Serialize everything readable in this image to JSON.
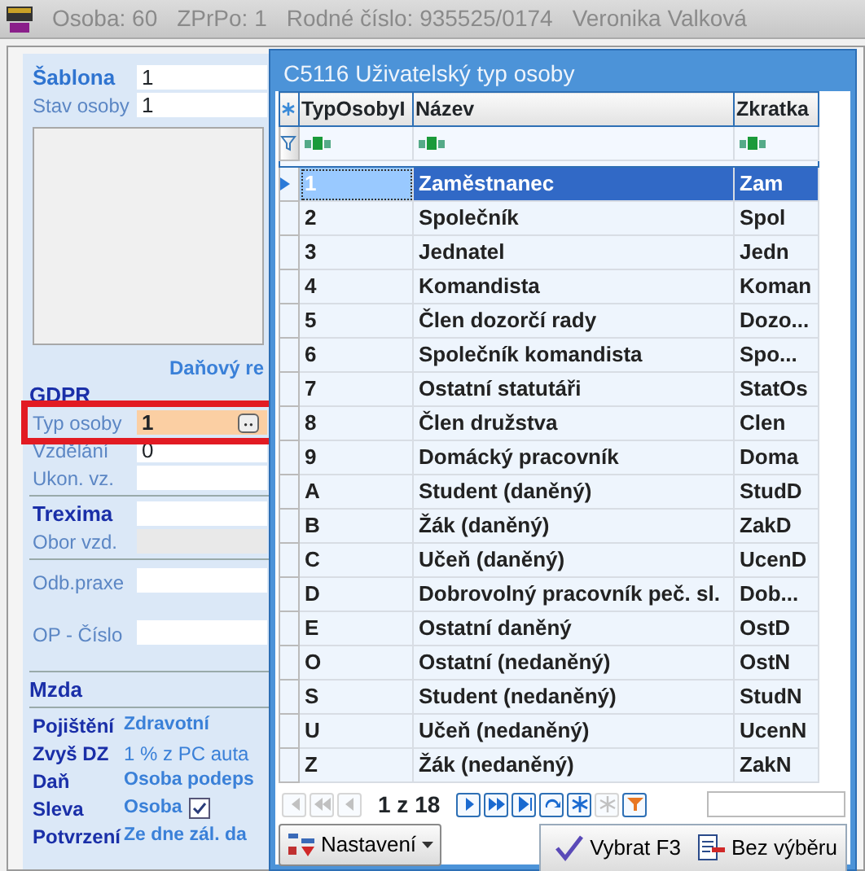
{
  "window": {
    "title_fields": [
      "Osoba: 60",
      "ZPrPo: 1",
      "Rodné číslo: 935525/0174",
      "Veronika Valková"
    ]
  },
  "form": [
    {
      "kind": "primary",
      "label": "Šablona",
      "value": "1"
    },
    {
      "kind": "number",
      "label": "Stav osoby",
      "value": "1"
    },
    {
      "kind": "photo"
    },
    {
      "kind": "caption",
      "label": "Daňový re"
    },
    {
      "kind": "section",
      "label": "GDPR"
    },
    {
      "kind": "lookup",
      "label": "Typ osoby",
      "value": "1",
      "highlighted": true
    },
    {
      "kind": "number",
      "label": "Vzdělání",
      "value": "0"
    },
    {
      "kind": "field",
      "label": "Ukon. vz."
    },
    {
      "kind": "divider"
    },
    {
      "kind": "group",
      "label": "Trexima"
    },
    {
      "kind": "field",
      "label": "Obor vzd.",
      "disabled": true
    },
    {
      "kind": "divider"
    },
    {
      "kind": "spaced",
      "label": "Odb.praxe"
    },
    {
      "kind": "spaced",
      "label": "OP - Číslo"
    },
    {
      "kind": "divider"
    },
    {
      "kind": "section",
      "label": "Mzda"
    },
    {
      "kind": "divider"
    },
    {
      "kind": "info",
      "label": "Pojištění",
      "value": "Zdravotní",
      "emphasis": true
    },
    {
      "kind": "info",
      "label": "Zvyš DZ",
      "value": "1 % z PC auta",
      "emphasis": false
    },
    {
      "kind": "info",
      "label": "Daň",
      "value": "Osoba podeps",
      "emphasis": true
    },
    {
      "kind": "info",
      "label": "Sleva",
      "value": "Osoba",
      "emphasis": true,
      "checked": true
    },
    {
      "kind": "info",
      "label": "Potvrzení",
      "value": "Ze dne zál. da",
      "emphasis": true
    }
  ],
  "dialog": {
    "title": "C5116 Uživatelský typ osoby",
    "columns": [
      "TypOsobyI",
      "Název",
      "Zkratka"
    ],
    "rows": [
      {
        "code": "1",
        "name": "Zaměstnanec",
        "abbr": "Zam",
        "selected": true
      },
      {
        "code": "2",
        "name": "Společník",
        "abbr": "Spol",
        "selected": false
      },
      {
        "code": "3",
        "name": "Jednatel",
        "abbr": "Jedn",
        "selected": false
      },
      {
        "code": "4",
        "name": "Komandista",
        "abbr": "Koman",
        "selected": false
      },
      {
        "code": "5",
        "name": "Člen dozorčí rady",
        "abbr": "Dozo...",
        "selected": false
      },
      {
        "code": "6",
        "name": "Společník komandista",
        "abbr": "Spo...",
        "selected": false
      },
      {
        "code": "7",
        "name": "Ostatní statutáři",
        "abbr": "StatOs",
        "selected": false
      },
      {
        "code": "8",
        "name": "Člen družstva",
        "abbr": "Clen",
        "selected": false
      },
      {
        "code": "9",
        "name": "Domácký pracovník",
        "abbr": "Doma",
        "selected": false
      },
      {
        "code": "A",
        "name": "Student (daněný)",
        "abbr": "StudD",
        "selected": false
      },
      {
        "code": "B",
        "name": "Žák (daněný)",
        "abbr": "ZakD",
        "selected": false
      },
      {
        "code": "C",
        "name": "Učeň (daněný)",
        "abbr": "UcenD",
        "selected": false
      },
      {
        "code": "D",
        "name": "Dobrovolný pracovník peč. sl.",
        "abbr": "Dob...",
        "selected": false
      },
      {
        "code": "E",
        "name": "Ostatní daněný",
        "abbr": "OstD",
        "selected": false
      },
      {
        "code": "O",
        "name": "Ostatní (nedaněný)",
        "abbr": "OstN",
        "selected": false
      },
      {
        "code": "S",
        "name": "Student (nedaněný)",
        "abbr": "StudN",
        "selected": false
      },
      {
        "code": "U",
        "name": "Učeň (nedaněný)",
        "abbr": "UcenN",
        "selected": false
      },
      {
        "code": "Z",
        "name": "Žák (nedaněný)",
        "abbr": "ZakN",
        "selected": false
      }
    ],
    "pager": {
      "text": "1 z 18",
      "buttons": [
        {
          "kind": "first",
          "disabled": true
        },
        {
          "kind": "prev-page",
          "disabled": true
        },
        {
          "kind": "prev",
          "disabled": true
        },
        {
          "kind": "next",
          "disabled": false
        },
        {
          "kind": "next-page",
          "disabled": false
        },
        {
          "kind": "last",
          "disabled": false
        },
        {
          "kind": "refresh",
          "disabled": false
        },
        {
          "kind": "add",
          "disabled": false
        },
        {
          "kind": "copy",
          "disabled": true
        },
        {
          "kind": "filter",
          "disabled": false
        }
      ]
    },
    "buttons": [
      {
        "kind": "menu",
        "label": "Nastavení"
      },
      {
        "kind": "ok",
        "label": "Vybrat F3"
      },
      {
        "kind": "clear",
        "label": "Bez výběru"
      }
    ]
  }
}
